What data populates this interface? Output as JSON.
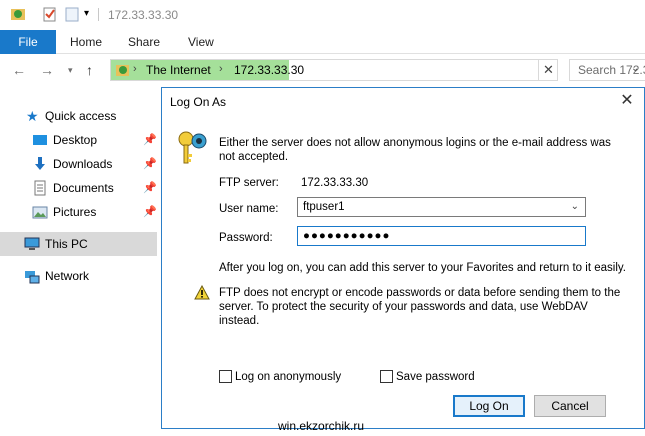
{
  "window": {
    "title": "172.33.33.30"
  },
  "ribbon": {
    "file_label": "File",
    "tabs": [
      "Home",
      "Share",
      "View"
    ]
  },
  "address": {
    "crumbs": [
      "The Internet",
      "172.33.33.30"
    ],
    "search_placeholder": "Search 172.3"
  },
  "sidebar": {
    "quick_access": "Quick access",
    "items": [
      {
        "label": "Desktop",
        "icon": "desktop-icon",
        "pinned": true
      },
      {
        "label": "Downloads",
        "icon": "downloads-icon",
        "pinned": true
      },
      {
        "label": "Documents",
        "icon": "documents-icon",
        "pinned": true
      },
      {
        "label": "Pictures",
        "icon": "pictures-icon",
        "pinned": true
      }
    ],
    "this_pc": "This PC",
    "network": "Network"
  },
  "dialog": {
    "title": "Log On As",
    "message": "Either the server does not allow anonymous logins or the e-mail address was not accepted.",
    "ftp_server_label": "FTP server:",
    "ftp_server_value": "172.33.33.30",
    "username_label": "User name:",
    "username_value": "ftpuser1",
    "password_label": "Password:",
    "password_value": "●●●●●●●●●●●",
    "after_logon": "After you log on, you can add this server to your Favorites and return to it easily.",
    "warning": "FTP does not encrypt or encode passwords or data before sending them to the server.  To protect the security of your passwords and data, use WebDAV instead.",
    "anon_label": "Log on anonymously",
    "save_pw_label": "Save password",
    "logon_button": "Log On",
    "cancel_button": "Cancel"
  },
  "watermark": "win.ekzorchik.ru",
  "colors": {
    "accent": "#1979ca",
    "address_highlight": "#a5e09a",
    "selected_item": "#d9d9d9"
  }
}
